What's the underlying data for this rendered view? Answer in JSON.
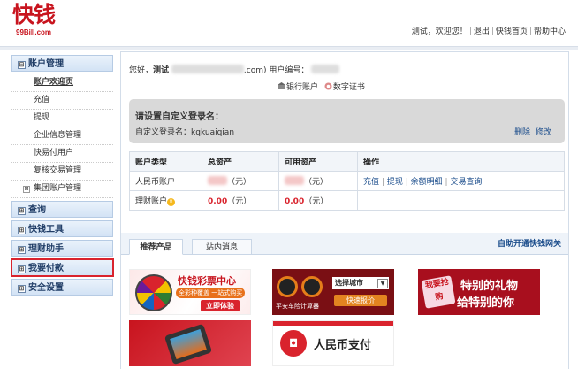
{
  "header": {
    "logo_text": "快钱",
    "logo_sub": "99Bill.com",
    "greeting": "测试，欢迎您！",
    "links": [
      "退出",
      "快钱首页",
      "帮助中心"
    ]
  },
  "sidebar": {
    "sections": [
      {
        "label": "账户管理",
        "toggle": "⊟",
        "items": [
          {
            "label": "账户欢迎页",
            "active": true
          },
          {
            "label": "充值"
          },
          {
            "label": "提现"
          },
          {
            "label": "企业信息管理"
          },
          {
            "label": "快易付用户"
          },
          {
            "label": "复核交易管理"
          },
          {
            "label": "集团账户管理",
            "toggle": "⊞"
          }
        ]
      },
      {
        "label": "查询",
        "toggle": "⊞"
      },
      {
        "label": "快钱工具",
        "toggle": "⊞"
      },
      {
        "label": "理财助手",
        "toggle": "⊞"
      },
      {
        "label": "我要付款",
        "toggle": "⊞",
        "highlighted": true
      },
      {
        "label": "安全设置",
        "toggle": "⊞"
      }
    ]
  },
  "welcome": {
    "prefix": "您好，",
    "name": "测试",
    "email_tail": ".com)",
    "account_label": "用户编号：",
    "bank_link": "银行账户",
    "cert_link": "数字证书"
  },
  "login_name": {
    "title": "请设置自定义登录名：",
    "label": "自定义登录名：",
    "value": "kqkuaiqian",
    "actions": [
      "删除",
      "修改"
    ]
  },
  "accounts": {
    "headers": [
      "账户类型",
      "总资产",
      "可用资产",
      "操作"
    ],
    "rows": [
      {
        "type": "人民币账户",
        "total": "（元）",
        "available": "（元）",
        "ops": [
          "充值",
          "提现",
          "余额明细",
          "交易查询"
        ]
      },
      {
        "type": "理财账户",
        "total": "0.00",
        "total_unit": "（元）",
        "available": "0.00",
        "available_unit": "（元）",
        "ops": []
      }
    ]
  },
  "products": {
    "tabs": [
      "推荐产品",
      "站内消息"
    ],
    "auto_link": "自助开通快钱网关",
    "banners": {
      "lottery": {
        "title": "快钱彩票中心",
        "tagline": "全彩种覆盖  一站式购买",
        "button": "立即体验"
      },
      "car": {
        "caption": "平安车险计算器",
        "select": "选择城市",
        "button": "快速报价"
      },
      "gift": {
        "badge": "我要抢购",
        "line1": "特别的礼物",
        "line2": "给特别的你"
      },
      "rmb": {
        "text": "人民币支付"
      }
    }
  },
  "colors": {
    "brand": "#c8141e",
    "link": "#1a4c8b",
    "sidebar_head": "#d3e3f5"
  }
}
